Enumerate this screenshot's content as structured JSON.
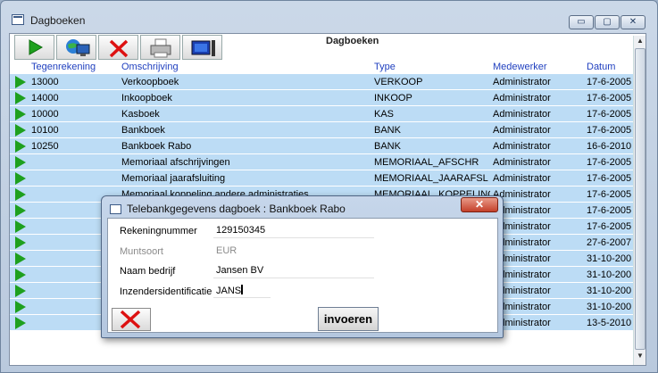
{
  "window": {
    "title": "Dagboeken",
    "min": "▭",
    "max": "▢",
    "close": "✕"
  },
  "form_title": "Dagboeken",
  "columns": {
    "tegenrekening": "Tegenrekening",
    "omschrijving": "Omschrijving",
    "type": "Type",
    "medewerker": "Medewerker",
    "datum": "Datum"
  },
  "rows": [
    {
      "rek": "13000",
      "oms": "Verkoopboek",
      "type": "VERKOOP",
      "mw": "Administrator",
      "datum": "17-6-2005"
    },
    {
      "rek": "14000",
      "oms": "Inkoopboek",
      "type": "INKOOP",
      "mw": "Administrator",
      "datum": "17-6-2005"
    },
    {
      "rek": "10000",
      "oms": "Kasboek",
      "type": "KAS",
      "mw": "Administrator",
      "datum": "17-6-2005"
    },
    {
      "rek": "10100",
      "oms": "Bankboek",
      "type": "BANK",
      "mw": "Administrator",
      "datum": "17-6-2005"
    },
    {
      "rek": "10250",
      "oms": "Bankboek Rabo",
      "type": "BANK",
      "mw": "Administrator",
      "datum": "16-6-2010"
    },
    {
      "rek": "",
      "oms": "Memoriaal afschrijvingen",
      "type": "MEMORIAAL_AFSCHR",
      "mw": "Administrator",
      "datum": "17-6-2005"
    },
    {
      "rek": "",
      "oms": "Memoriaal jaarafsluiting",
      "type": "MEMORIAAL_JAARAFSL",
      "mw": "Administrator",
      "datum": "17-6-2005"
    },
    {
      "rek": "",
      "oms": "Memoriaal koppeling andere administraties",
      "type": "MEMORIAAL_KOPPELING",
      "mw": "Administrator",
      "datum": "17-6-2005"
    },
    {
      "rek": "",
      "oms": "",
      "type": "",
      "mw": "Administrator",
      "datum": "17-6-2005"
    },
    {
      "rek": "",
      "oms": "",
      "type": "",
      "mw": "Administrator",
      "datum": "17-6-2005"
    },
    {
      "rek": "",
      "oms": "",
      "type": "",
      "mw": "Administrator",
      "datum": "27-6-2007"
    },
    {
      "rek": "",
      "oms": "",
      "type": "",
      "mw": "Administrator",
      "datum": "31-10-200"
    },
    {
      "rek": "",
      "oms": "",
      "type": "",
      "mw": "Administrator",
      "datum": "31-10-200"
    },
    {
      "rek": "",
      "oms": "",
      "type": "",
      "mw": "Administrator",
      "datum": "31-10-200"
    },
    {
      "rek": "",
      "oms": "",
      "type": "",
      "mw": "Administrator",
      "datum": "31-10-200"
    },
    {
      "rek": "",
      "oms": "",
      "type": "",
      "mw": "Administrator",
      "datum": "13-5-2010"
    }
  ],
  "dialog": {
    "title": "Telebankgegevens dagboek : Bankboek Rabo",
    "close": "✕",
    "fields": {
      "rekeningnummer": {
        "label": "Rekeningnummer",
        "value": "129150345"
      },
      "muntsoort": {
        "label": "Muntsoort",
        "value": "EUR"
      },
      "naam": {
        "label": "Naam bedrijf",
        "value": "Jansen BV"
      },
      "inzender": {
        "label": "Inzendersidentificatie",
        "value": "JANS"
      }
    },
    "submit_label": "invoeren"
  },
  "colors": {
    "row_bg": "#bcdcf5",
    "header_text": "#1f3fbf",
    "play": "#1ea01e"
  }
}
